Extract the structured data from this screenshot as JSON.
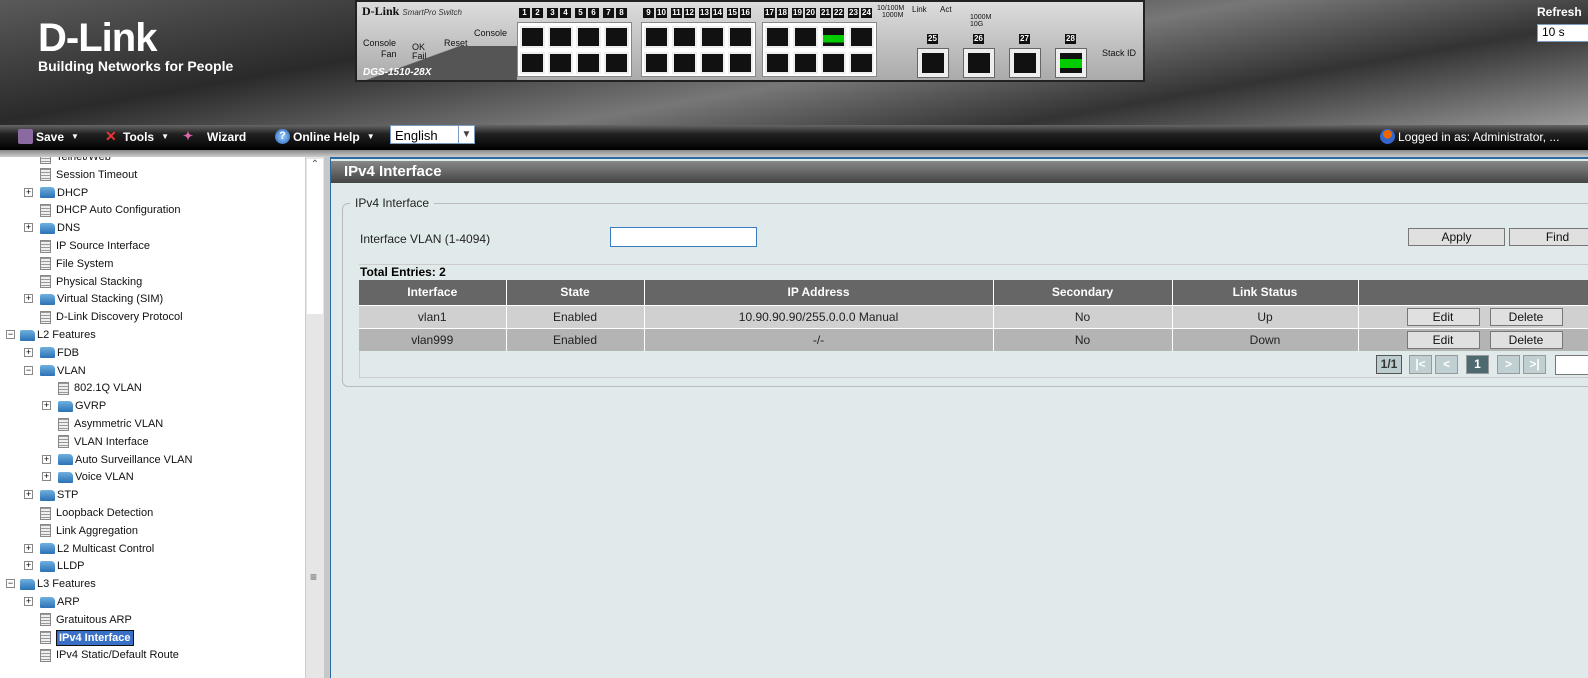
{
  "header": {
    "logo": "D-Link",
    "tagline": "Building Networks for People",
    "refresh_label": "Refresh",
    "refresh_value": "10 s"
  },
  "device": {
    "brand": "D-Link",
    "series": "SmartPro Switch",
    "model": "DGS-1510-28X",
    "labels": {
      "console": "Console",
      "fan": "Fan",
      "ok": "OK",
      "fail": "Fail",
      "reset": "Reset",
      "console_port": "Console",
      "speed1": "10/100M",
      "speed2": "1000M",
      "speed3": "1000M",
      "speed4": "10G",
      "link": "Link",
      "act": "Act",
      "stack_id": "Stack ID"
    },
    "ports": [
      "1",
      "2",
      "3",
      "4",
      "5",
      "6",
      "7",
      "8",
      "9",
      "10",
      "11",
      "12",
      "13",
      "14",
      "15",
      "16",
      "17",
      "18",
      "19",
      "20",
      "21",
      "22",
      "23",
      "24"
    ],
    "sfp_ports": [
      "25",
      "26",
      "27",
      "28"
    ],
    "active_ports": [
      "21",
      "28"
    ],
    "link_color": "#00cc00"
  },
  "toolbar": {
    "save": "Save",
    "tools": "Tools",
    "wizard": "Wizard",
    "help": "Online Help",
    "language": "English",
    "logged_in": "Logged in as: Administrator, ..."
  },
  "tree": [
    {
      "label": "Telnet/Web",
      "level": 1,
      "type": "doc"
    },
    {
      "label": "Session Timeout",
      "level": 1,
      "type": "doc"
    },
    {
      "label": "DHCP",
      "level": 1,
      "type": "folder",
      "expander": "+"
    },
    {
      "label": "DHCP Auto Configuration",
      "level": 1,
      "type": "doc"
    },
    {
      "label": "DNS",
      "level": 1,
      "type": "folder",
      "expander": "+"
    },
    {
      "label": "IP Source Interface",
      "level": 1,
      "type": "doc"
    },
    {
      "label": "File System",
      "level": 1,
      "type": "doc"
    },
    {
      "label": "Physical Stacking",
      "level": 1,
      "type": "doc"
    },
    {
      "label": "Virtual Stacking (SIM)",
      "level": 1,
      "type": "folder",
      "expander": "+"
    },
    {
      "label": "D-Link Discovery Protocol",
      "level": 1,
      "type": "doc"
    },
    {
      "label": "L2 Features",
      "level": 0,
      "type": "folder",
      "expander": "-"
    },
    {
      "label": "FDB",
      "level": 1,
      "type": "folder",
      "expander": "+"
    },
    {
      "label": "VLAN",
      "level": 1,
      "type": "folder",
      "expander": "-"
    },
    {
      "label": "802.1Q VLAN",
      "level": 2,
      "type": "doc"
    },
    {
      "label": "GVRP",
      "level": 2,
      "type": "folder",
      "expander": "+"
    },
    {
      "label": "Asymmetric VLAN",
      "level": 2,
      "type": "doc"
    },
    {
      "label": "VLAN Interface",
      "level": 2,
      "type": "doc"
    },
    {
      "label": "Auto Surveillance VLAN",
      "level": 2,
      "type": "folder",
      "expander": "+"
    },
    {
      "label": "Voice VLAN",
      "level": 2,
      "type": "folder",
      "expander": "+"
    },
    {
      "label": "STP",
      "level": 1,
      "type": "folder",
      "expander": "+"
    },
    {
      "label": "Loopback Detection",
      "level": 1,
      "type": "doc"
    },
    {
      "label": "Link Aggregation",
      "level": 1,
      "type": "doc"
    },
    {
      "label": "L2 Multicast Control",
      "level": 1,
      "type": "folder",
      "expander": "+"
    },
    {
      "label": "LLDP",
      "level": 1,
      "type": "folder",
      "expander": "+"
    },
    {
      "label": "L3 Features",
      "level": 0,
      "type": "folder",
      "expander": "-"
    },
    {
      "label": "ARP",
      "level": 1,
      "type": "folder",
      "expander": "+"
    },
    {
      "label": "Gratuitous ARP",
      "level": 1,
      "type": "doc"
    },
    {
      "label": "IPv4 Interface",
      "level": 1,
      "type": "doc",
      "selected": true
    },
    {
      "label": "IPv4 Static/Default Route",
      "level": 1,
      "type": "doc"
    }
  ],
  "main": {
    "title": "IPv4 Interface",
    "section": "IPv4 Interface",
    "vlan_label": "Interface VLAN (1-4094)",
    "vlan_value": "",
    "apply": "Apply",
    "find": "Find",
    "total": "Total Entries: 2",
    "columns": [
      "Interface",
      "State",
      "IP Address",
      "Secondary",
      "Link Status",
      ""
    ],
    "rows": [
      {
        "interface": "vlan1",
        "state": "Enabled",
        "ip": "10.90.90.90/255.0.0.0 Manual",
        "secondary": "No",
        "link": "Up",
        "edit": "Edit",
        "delete": "Delete"
      },
      {
        "interface": "vlan999",
        "state": "Enabled",
        "ip": "-/-",
        "secondary": "No",
        "link": "Down",
        "edit": "Edit",
        "delete": "Delete"
      }
    ],
    "pager": {
      "page_of": "1/1",
      "first": "|<",
      "prev": "<",
      "current": "1",
      "next": ">",
      "last": ">|"
    }
  }
}
